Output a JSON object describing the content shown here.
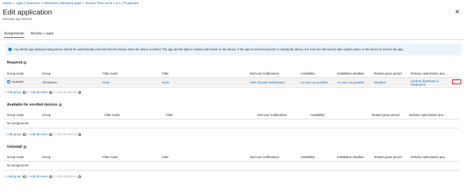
{
  "breadcrumb": {
    "items": [
      "Home",
      "Apps | Overview",
      "Windows | Windows apps",
      "Device Time Zone 1.0.1 | Properties"
    ],
    "separator": ">"
  },
  "header": {
    "title": "Edit application",
    "more_label": "···",
    "subtitle": "Windows app (Win32)",
    "close_label": "✕"
  },
  "tabs": [
    {
      "label": "Assignments",
      "active": true
    },
    {
      "label": "Review + save",
      "active": false
    }
  ],
  "info_bar": {
    "text": "Any Win32 app deployed using Intune will not be automatically removed from the device when the device is retired. The app and the data it contains will remain on the device. If the app is not removed prior to retiring the device, the end user will need to take explicit action on the device to remove the app."
  },
  "actions": {
    "add_group": "+ Add group",
    "add_all_users": "+ Add all users",
    "add_all_devices": "+ Add all devices",
    "separator": "|"
  },
  "required": {
    "title": "Required",
    "columns": [
      "Group mode",
      "Group",
      "Filter mode",
      "Filter",
      "End user notifications",
      "Availability",
      "Installation deadline",
      "Restart grace period",
      "Delivery optimization prio..."
    ],
    "row": {
      "group_mode": "Included",
      "group": "All devices",
      "filter_mode": "None",
      "filter": "None",
      "end_user_notifications": "Hide all toast notifications",
      "availability": "As soon as possible",
      "installation_deadline": "As soon as possible",
      "restart_grace_period": "Disabled",
      "delivery_optimization_line1": "Content download in",
      "delivery_optimization_line2": "foreground",
      "more_label": "···"
    }
  },
  "available": {
    "title": "Available for enrolled devices",
    "columns": [
      "Group mode",
      "Group",
      "Filter mode",
      "Filter",
      "End user notifications",
      "Availability",
      "Restart grace period",
      "Delivery optimization prio..."
    ],
    "empty_text": "No assignments"
  },
  "uninstall": {
    "title": "Uninstall",
    "columns": [
      "Group mode",
      "Group",
      "Filter mode",
      "Filter",
      "End user notifications",
      "Availability",
      "Installation deadline",
      "Restart grace period",
      "Delivery optimization prio..."
    ],
    "empty_text": "No assignments"
  },
  "colors": {
    "accent": "#0f6cbd",
    "info_background": "#ebf3fc",
    "highlight_border": "#e81123",
    "selected_row": "#f3f2f1"
  }
}
